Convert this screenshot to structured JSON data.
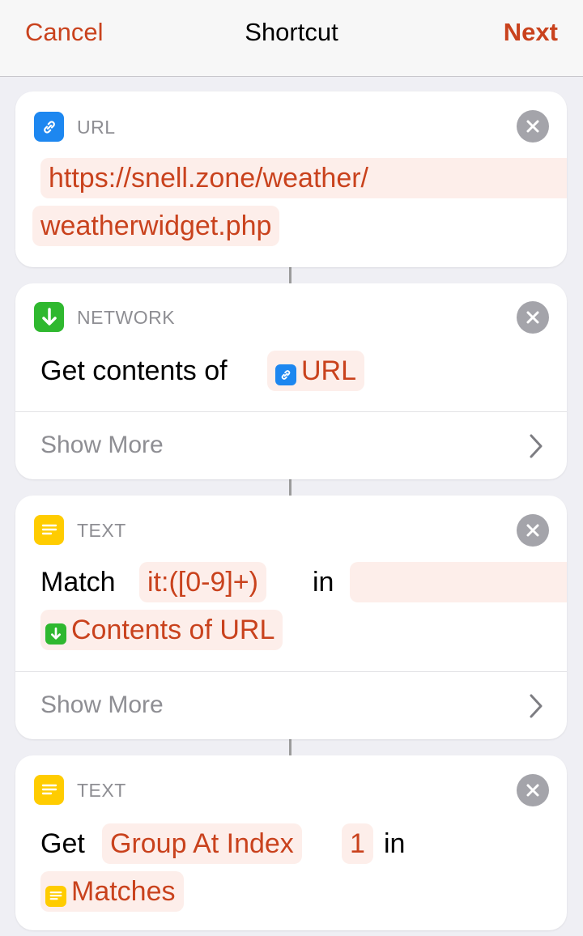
{
  "nav": {
    "cancel": "Cancel",
    "title": "Shortcut",
    "next": "Next"
  },
  "colors": {
    "accent": "#c9421d",
    "url_blue": "#1d87f0",
    "network_green": "#2fb82f",
    "text_yellow": "#ffcc00"
  },
  "cards": {
    "url": {
      "category": "URL",
      "icon": "link-icon",
      "url_line1": "https://snell.zone/weather/",
      "url_line2": "weatherwidget.php"
    },
    "network": {
      "category": "NETWORK",
      "icon": "download-arrow-icon",
      "action_text": "Get contents of",
      "token": "URL",
      "show_more": "Show More"
    },
    "match": {
      "category": "TEXT",
      "icon": "text-lines-icon",
      "action_text": "Match",
      "pattern": "it:([0-9]+)",
      "in_text": "in",
      "input_token": "Contents of URL",
      "show_more": "Show More"
    },
    "group": {
      "category": "TEXT",
      "icon": "text-lines-icon",
      "action_text": "Get",
      "option_token": "Group At Index",
      "index_token": "1",
      "in_text": "in",
      "input_token": "Matches"
    }
  }
}
